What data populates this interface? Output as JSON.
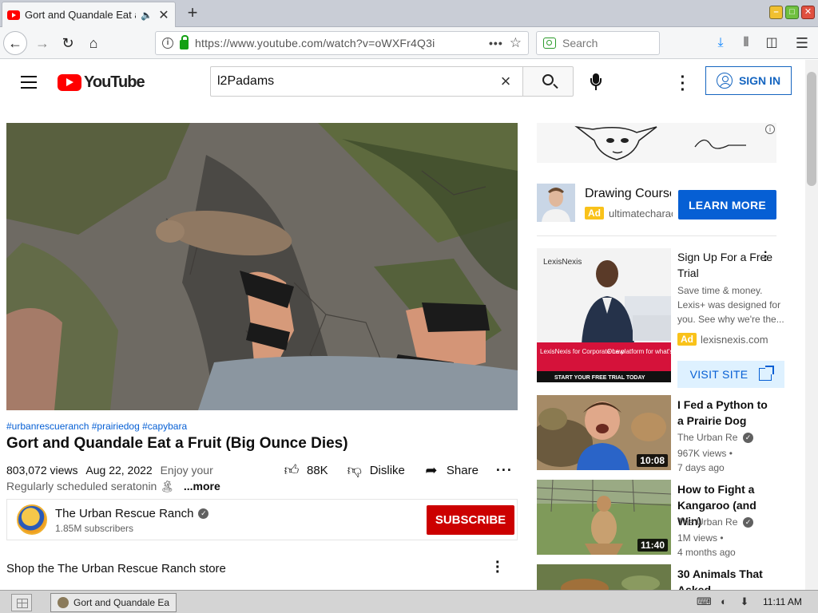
{
  "browser": {
    "tab_title": "Gort and Quandale Eat a Fruit (Big Ounce Dies) - YouTube",
    "url": "https://www.youtube.com/watch?v=oWXFr4Q3i",
    "search_placeholder": "Search",
    "new_tab": "+"
  },
  "youtube": {
    "logo_text": "YouTube",
    "search_query": "l2Padams",
    "sign_in": "SIGN IN"
  },
  "video": {
    "hashtags": "#urbanrescueranch #prairiedog #capybara",
    "title": "Gort and Quandale Eat a Fruit (Big Ounce Dies)",
    "views": "803,072 views",
    "date": "Aug 22, 2022",
    "desc_line1": "Enjoy your",
    "desc_line2": "Regularly scheduled seratonin 🏝",
    "more": "...more",
    "likes": "88K",
    "dislike": "Dislike",
    "share": "Share"
  },
  "channel": {
    "name": "The Urban Rescue Ranch",
    "subscribers": "1.85M subscribers",
    "subscribe": "SUBSCRIBE"
  },
  "shop": {
    "label": "Shop the The Urban Rescue Ranch store"
  },
  "ads": {
    "ad1": {
      "title": "Drawing Course",
      "badge": "Ad",
      "domain": "ultimatecharacter.com",
      "cta": "LEARN MORE"
    },
    "ad2": {
      "title": "Sign Up For a Free Trial",
      "description": "Save time & money. Lexis+ was designed for you. See why we're the...",
      "badge": "Ad",
      "domain": "lexisnexis.com",
      "cta": "VISIT SITE",
      "image_brand": "LexisNexis",
      "image_line1": "LexisNexis for Corporate Law",
      "image_line2": "One platform for what's next.",
      "image_cta": "START YOUR FREE TRIAL TODAY"
    }
  },
  "recommendations": [
    {
      "title": "I Fed a Python to a Prairie Dog",
      "channel": "The Urban Rescue Ranch",
      "views": "967K views",
      "age": "7 days ago",
      "duration": "10:08"
    },
    {
      "title": "How to Fight a Kangaroo (and Win)",
      "channel": "The Urban Rescue Ranch",
      "views": "1M views",
      "age": "4 months ago",
      "duration": "11:40"
    },
    {
      "title": "30 Animals That Asked",
      "channel": "",
      "views": "",
      "age": "",
      "duration": ""
    }
  ],
  "taskbar": {
    "window_title": "Gort and Quandale Eat a Fruit (Big Ounce Dies) - YouTube",
    "clock": "11:11 AM"
  },
  "colors": {
    "yt_red": "#ff0000",
    "subscribe_red": "#cc0000",
    "link_blue": "#065fd4",
    "ad_yellow": "#f9c21a"
  }
}
